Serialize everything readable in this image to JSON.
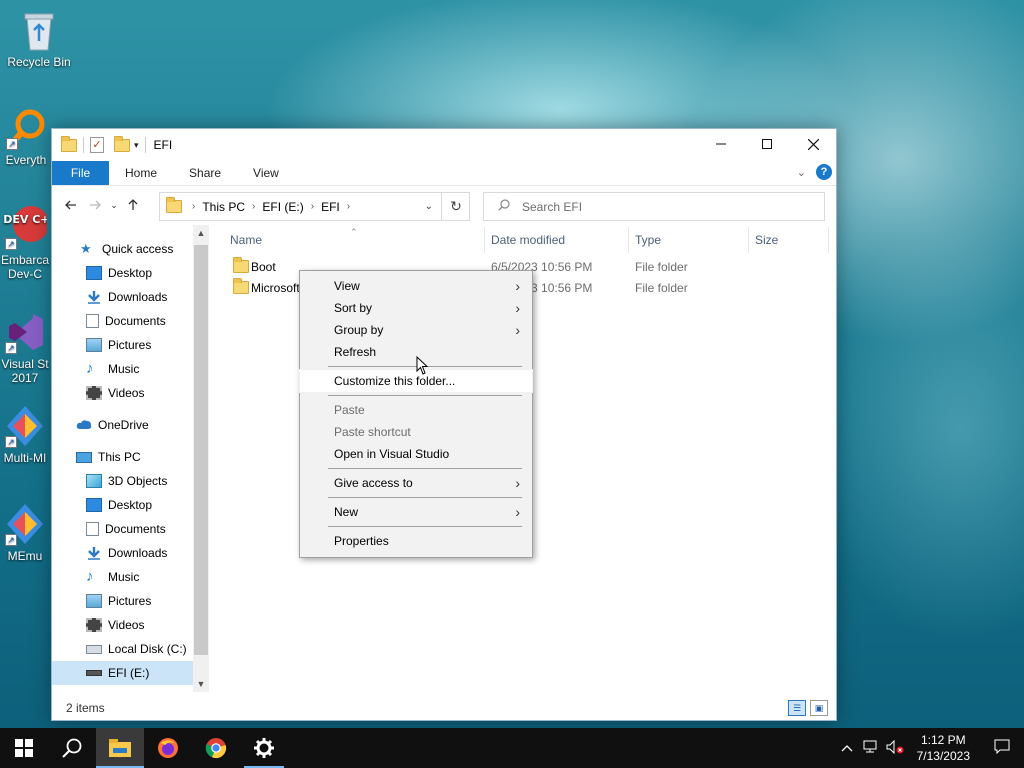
{
  "desktop": {
    "icons": [
      {
        "label": "Recycle Bin"
      },
      {
        "label": "Everyth"
      },
      {
        "label": "Embarca Dev-C"
      },
      {
        "label": "Visual St 2017"
      },
      {
        "label": "Multi-MI"
      },
      {
        "label": "MEmu"
      }
    ],
    "dev_badge": "DEV C++"
  },
  "window": {
    "title": "EFI",
    "ribbon_tabs": [
      "File",
      "Home",
      "Share",
      "View"
    ],
    "help": "?",
    "address": {
      "crumbs": [
        "This PC",
        "EFI (E:)",
        "EFI"
      ]
    },
    "search": {
      "placeholder": "Search EFI"
    },
    "nav": {
      "quick_access": "Quick access",
      "quick_items": [
        "Desktop",
        "Downloads",
        "Documents",
        "Pictures",
        "Music",
        "Videos"
      ],
      "onedrive": "OneDrive",
      "this_pc": "This PC",
      "pc_items": [
        "3D Objects",
        "Desktop",
        "Documents",
        "Downloads",
        "Music",
        "Pictures",
        "Videos",
        "Local Disk (C:)",
        "EFI (E:)"
      ],
      "selected": "EFI (E:)"
    },
    "columns": {
      "name": "Name",
      "date": "Date modified",
      "type": "Type",
      "size": "Size"
    },
    "files": [
      {
        "name": "Boot",
        "date": "6/5/2023 10:56 PM",
        "type": "File folder"
      },
      {
        "name": "Microsoft",
        "date": "6/5/2023 10:56 PM",
        "type": "File folder"
      }
    ],
    "status": "2 items"
  },
  "context_menu": {
    "groups": [
      [
        {
          "label": "View",
          "submenu": true
        },
        {
          "label": "Sort by",
          "submenu": true
        },
        {
          "label": "Group by",
          "submenu": true
        },
        {
          "label": "Refresh"
        }
      ],
      [
        {
          "label": "Customize this folder...",
          "hover": true
        }
      ],
      [
        {
          "label": "Paste",
          "disabled": true
        },
        {
          "label": "Paste shortcut",
          "disabled": true
        },
        {
          "label": "Open in Visual Studio"
        }
      ],
      [
        {
          "label": "Give access to",
          "submenu": true
        }
      ],
      [
        {
          "label": "New",
          "submenu": true
        }
      ],
      [
        {
          "label": "Properties"
        }
      ]
    ]
  },
  "taskbar": {
    "clock_time": "1:12 PM",
    "clock_date": "7/13/2023"
  },
  "colors": {
    "accent": "#1979ca",
    "taskbar": "#101010",
    "selection": "#cce4f7",
    "menu_bg": "#f2f2f2"
  }
}
